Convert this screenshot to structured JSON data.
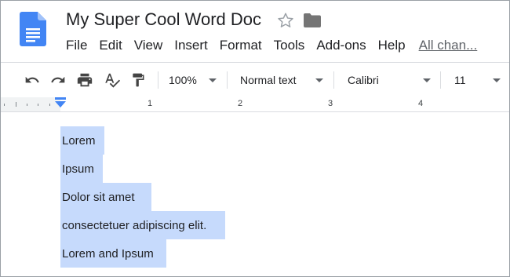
{
  "header": {
    "title": "My Super Cool Word Doc",
    "menu": [
      "File",
      "Edit",
      "View",
      "Insert",
      "Format",
      "Tools",
      "Add-ons",
      "Help"
    ],
    "changes_link": "All chan..."
  },
  "toolbar": {
    "zoom": "100%",
    "style": "Normal text",
    "font": "Calibri",
    "size": "11"
  },
  "ruler": {
    "numbers": [
      "1",
      "2",
      "3",
      "4"
    ]
  },
  "document": {
    "lines": [
      "Lorem",
      "Ipsum",
      "Dolor sit amet",
      "consectetuer adipiscing elit.",
      "Lorem and Ipsum"
    ]
  },
  "colors": {
    "accent": "#4285f4",
    "selection": "#c6dafc",
    "doc_icon": "#4285f4"
  }
}
